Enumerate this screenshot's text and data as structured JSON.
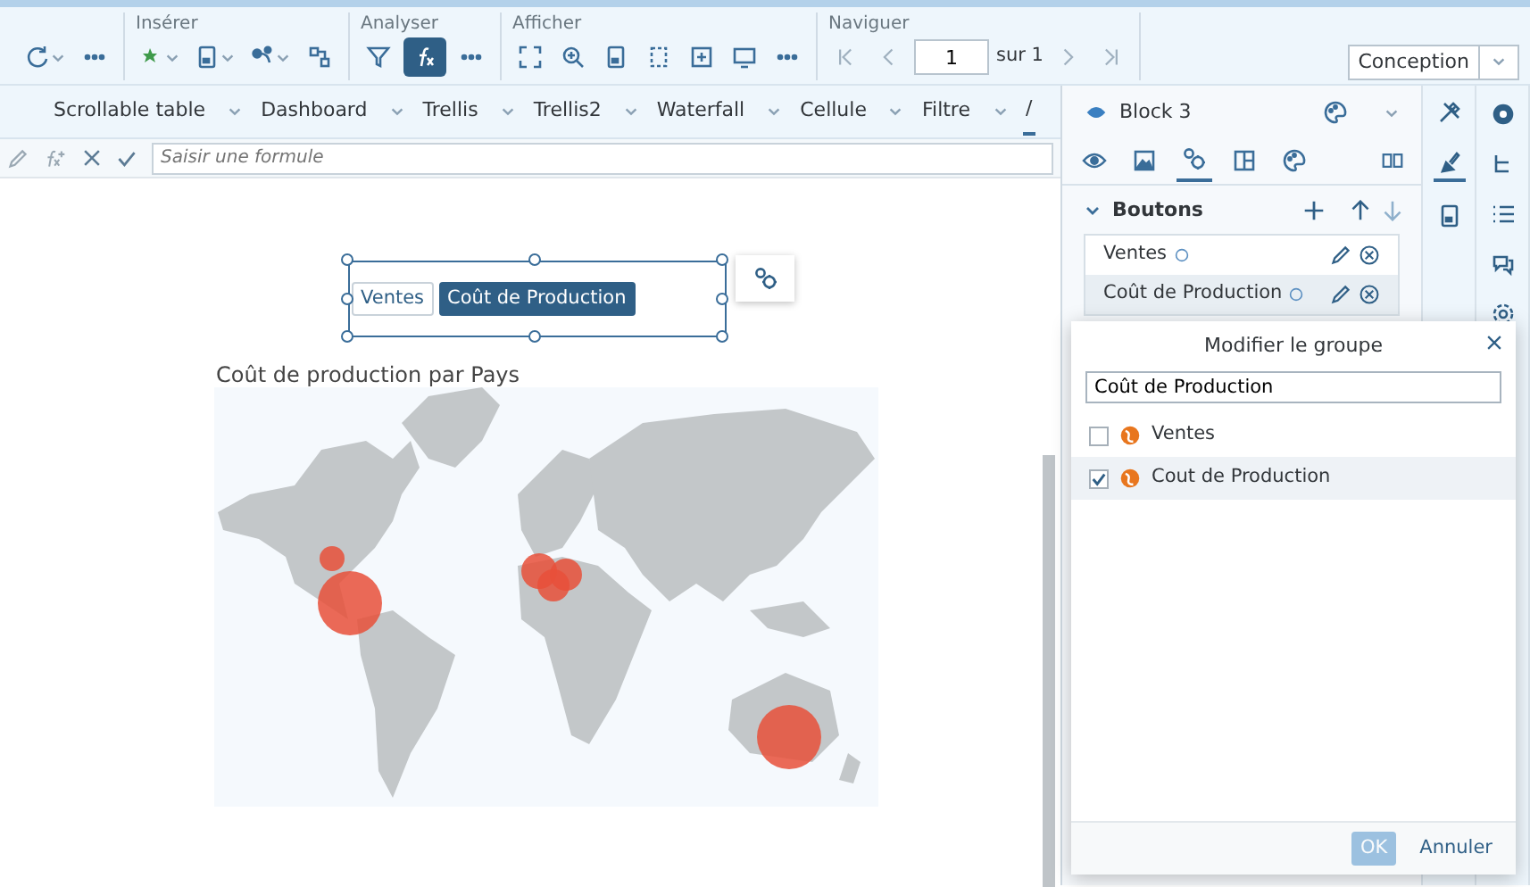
{
  "toolbar": {
    "groups": [
      {
        "tools": [
          {
            "kind": "refresh",
            "dropdown": true,
            "selected": false
          },
          {
            "kind": "more",
            "dropdown": false,
            "selected": false
          }
        ]
      },
      {
        "label": "Insérer",
        "tools": [
          {
            "kind": "chart",
            "dropdown": true,
            "selected": false
          },
          {
            "kind": "doc",
            "dropdown": true,
            "selected": false
          },
          {
            "kind": "share",
            "dropdown": true,
            "selected": false
          },
          {
            "kind": "grid",
            "dropdown": false,
            "selected": false
          }
        ]
      },
      {
        "label": "Analyser",
        "tools": [
          {
            "kind": "filter",
            "dropdown": false,
            "selected": false
          },
          {
            "kind": "formula",
            "dropdown": false,
            "selected": true
          },
          {
            "kind": "more",
            "dropdown": false,
            "selected": false
          }
        ]
      },
      {
        "label": "Afficher",
        "tools": [
          {
            "kind": "fit",
            "dropdown": false,
            "selected": false
          },
          {
            "kind": "zoom",
            "dropdown": false,
            "selected": false
          },
          {
            "kind": "doc",
            "dropdown": false,
            "selected": false
          },
          {
            "kind": "page",
            "dropdown": false,
            "selected": false
          },
          {
            "kind": "add",
            "dropdown": false,
            "selected": false
          },
          {
            "kind": "screen",
            "dropdown": false,
            "selected": false
          },
          {
            "kind": "more",
            "dropdown": false,
            "selected": false
          }
        ]
      }
    ],
    "navigator": {
      "label": "Naviguer",
      "page": "1",
      "total": "sur 1"
    },
    "mode_button": "Conception"
  },
  "report_tabs": [
    {
      "label": "Scrollable table",
      "selected": false
    },
    {
      "label": "Dashboard",
      "selected": false
    },
    {
      "label": "Trellis",
      "selected": false
    },
    {
      "label": "Trellis2",
      "selected": false
    },
    {
      "label": "Waterfall",
      "selected": false
    },
    {
      "label": "Cellule",
      "selected": false
    },
    {
      "label": "Filtre",
      "selected": false
    },
    {
      "label": "/",
      "selected": true
    }
  ],
  "formula_bar": {
    "placeholder": "Saisir une formule"
  },
  "canvas": {
    "button_group": [
      {
        "label": "Ventes",
        "selected": false
      },
      {
        "label": "Coût de Production",
        "selected": true
      }
    ],
    "map": {
      "title": "Coût de production par Pays"
    }
  },
  "panel": {
    "title": "Block 3",
    "tabs": [
      {
        "kind": "eye",
        "selected": false
      },
      {
        "kind": "image",
        "selected": false
      },
      {
        "kind": "gears",
        "selected": true
      },
      {
        "kind": "layout",
        "selected": false
      },
      {
        "kind": "palette",
        "selected": false
      }
    ],
    "section": {
      "title": "Boutons",
      "expanded": true,
      "items": [
        {
          "label": "Ventes",
          "selected": false
        },
        {
          "label": "Coût de Production",
          "selected": true
        }
      ]
    }
  },
  "side_tabs": [
    {
      "kind": "tools",
      "selected": false
    },
    {
      "kind": "brush",
      "selected": true
    },
    {
      "kind": "doc",
      "selected": false
    }
  ],
  "dialog": {
    "title": "Modifier le groupe",
    "value": "Coût de Production",
    "options": [
      {
        "label": "Ventes",
        "checked": false
      },
      {
        "label": "Cout de Production",
        "checked": true
      }
    ],
    "buttons": [
      {
        "label": "OK",
        "disabled": true
      },
      {
        "label": "Annuler",
        "disabled": false
      }
    ]
  }
}
